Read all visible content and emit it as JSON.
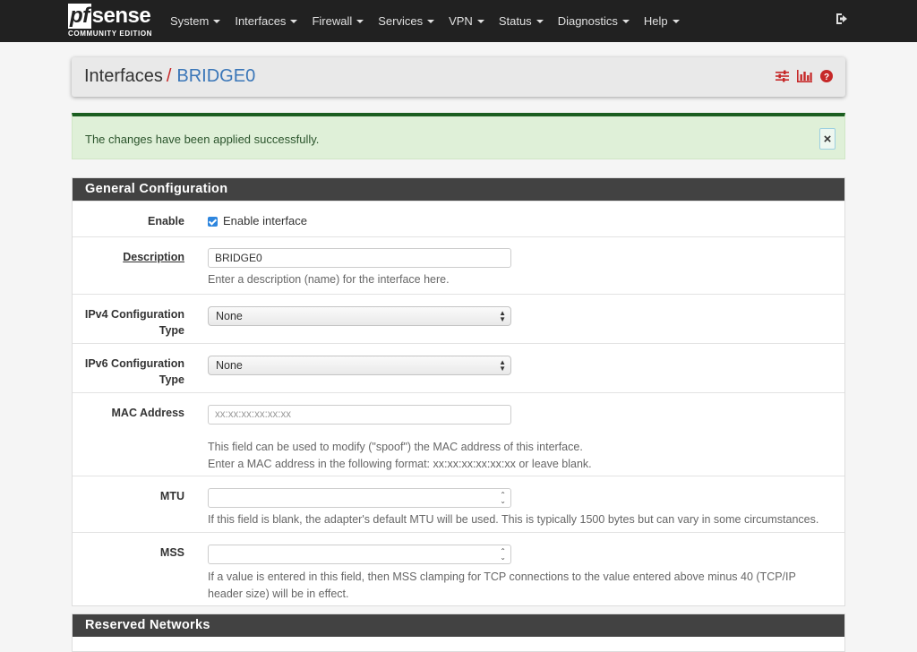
{
  "nav": {
    "brand_pf": "pf",
    "brand_sense": "sense",
    "brand_sub": "COMMUNITY EDITION",
    "items": [
      "System",
      "Interfaces",
      "Firewall",
      "Services",
      "VPN",
      "Status",
      "Diagnostics",
      "Help"
    ]
  },
  "breadcrumb": {
    "section": "Interfaces",
    "separator": "/",
    "current": "BRIDGE0"
  },
  "alert": {
    "message": "The changes have been applied successfully.",
    "close_label": "×"
  },
  "general": {
    "heading": "General Configuration",
    "enable_label": "Enable",
    "enable_checkbox_label": "Enable interface",
    "enable_checked": true,
    "description_label": "Description",
    "description_value": "BRIDGE0",
    "description_help": "Enter a description (name) for the interface here.",
    "ipv4_label_1": "IPv4 Configuration",
    "ipv4_label_2": "Type",
    "ipv4_value": "None",
    "ipv6_label_1": "IPv6 Configuration",
    "ipv6_label_2": "Type",
    "ipv6_value": "None",
    "mac_label": "MAC Address",
    "mac_placeholder": "xx:xx:xx:xx:xx:xx",
    "mac_help_1": "This field can be used to modify (\"spoof\") the MAC address of this interface.",
    "mac_help_2": "Enter a MAC address in the following format: xx:xx:xx:xx:xx:xx or leave blank.",
    "mtu_label": "MTU",
    "mtu_value": "",
    "mtu_help": "If this field is blank, the adapter's default MTU will be used. This is typically 1500 bytes but can vary in some circumstances.",
    "mss_label": "MSS",
    "mss_value": "",
    "mss_help_1": "If a value is entered in this field, then MSS clamping for TCP connections to the value entered above minus 40 (TCP/IP",
    "mss_help_2": "header size) will be in effect."
  },
  "reserved": {
    "heading": "Reserved Networks"
  },
  "colors": {
    "navbar": "#212121",
    "panel_heading": "#424242",
    "accent_red": "#c62828",
    "link_blue": "#3a76b8",
    "success_bg": "#dff0d8",
    "success_border": "#1b5e20"
  },
  "icons": [
    "sliders-icon",
    "bar-chart-icon",
    "help-circle-icon",
    "logout-icon"
  ]
}
